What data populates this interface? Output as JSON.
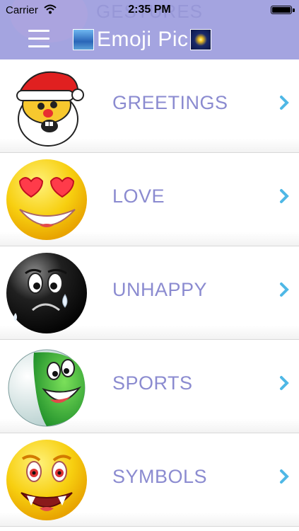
{
  "status_bar": {
    "carrier": "Carrier",
    "time": "2:35 PM"
  },
  "header": {
    "ghost_title": "GESTURES",
    "title": "Emoji Pic",
    "background_color": "#a4a4e0"
  },
  "categories": [
    {
      "label": "GREETINGS",
      "icon": "santa-emoji-icon"
    },
    {
      "label": "LOVE",
      "icon": "heart-eyes-emoji-icon"
    },
    {
      "label": "UNHAPPY",
      "icon": "crying-emoji-icon"
    },
    {
      "label": "SPORTS",
      "icon": "football-emoji-icon"
    },
    {
      "label": "SYMBOLS",
      "icon": "vampire-emoji-icon"
    }
  ],
  "colors": {
    "label_text": "#8b8bd0",
    "chevron": "#4fb8e6"
  }
}
